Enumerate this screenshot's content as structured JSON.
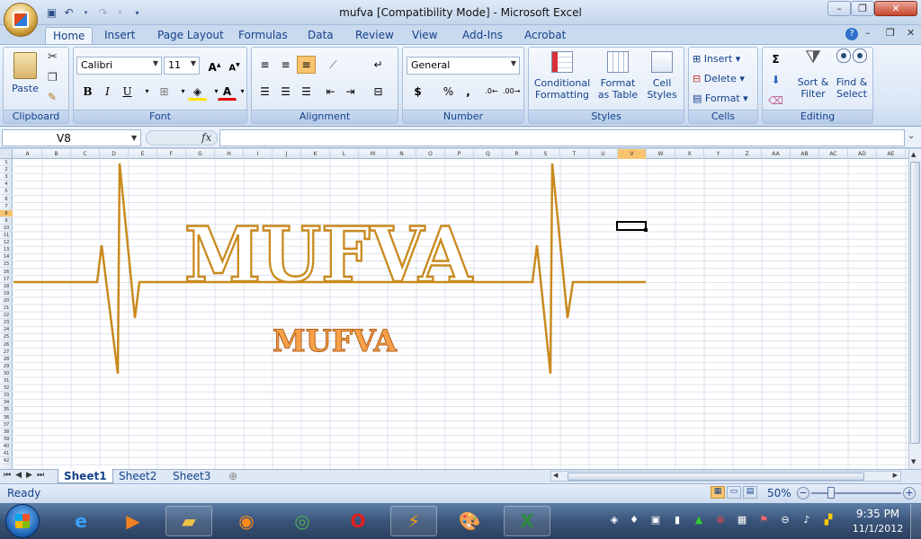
{
  "window": {
    "title": "mufva  [Compatibility Mode] - Microsoft Excel",
    "minimize": "–",
    "maximize": "❐",
    "close": "✕"
  },
  "ribbon_tabs": [
    "Home",
    "Insert",
    "Page Layout",
    "Formulas",
    "Data",
    "Review",
    "View",
    "Add-Ins",
    "Acrobat"
  ],
  "groups": {
    "clipboard": {
      "label": "Clipboard",
      "paste": "Paste"
    },
    "font": {
      "label": "Font",
      "family": "Calibri",
      "size": "11"
    },
    "alignment": {
      "label": "Alignment"
    },
    "number": {
      "label": "Number",
      "format": "General",
      "currency": "$",
      "percent": "%",
      "comma": ","
    },
    "styles": {
      "label": "Styles",
      "conditional": "Conditional",
      "formatting": "Formatting",
      "format_as": "Format",
      "as_table": "as Table",
      "cell": "Cell",
      "cell_styles": "Styles"
    },
    "cells": {
      "label": "Cells",
      "insert": "Insert",
      "delete": "Delete",
      "format": "Format"
    },
    "editing": {
      "label": "Editing",
      "sort": "Sort &",
      "filter": "Filter",
      "find": "Find &",
      "select": "Select"
    }
  },
  "formula_bar": {
    "name_box": "V8",
    "fx": "fx",
    "content": ""
  },
  "columns": [
    "A",
    "B",
    "C",
    "D",
    "E",
    "F",
    "G",
    "H",
    "I",
    "J",
    "K",
    "L",
    "M",
    "N",
    "O",
    "P",
    "Q",
    "R",
    "S",
    "T",
    "U",
    "V",
    "W",
    "X",
    "Y",
    "Z",
    "AA",
    "AB",
    "AC",
    "AD",
    "AE"
  ],
  "rows": [
    "1",
    "2",
    "3",
    "4",
    "5",
    "6",
    "7",
    "8",
    "9",
    "10",
    "11",
    "12",
    "13",
    "14",
    "15",
    "16",
    "17",
    "18",
    "19",
    "20",
    "21",
    "22",
    "23",
    "24",
    "25",
    "26",
    "27",
    "28",
    "29",
    "30",
    "31",
    "32",
    "33",
    "34",
    "35",
    "36",
    "37",
    "38",
    "39",
    "40",
    "41",
    "42"
  ],
  "active_column": "V",
  "active_row": "8",
  "artwork": {
    "big_text": "MUFVA",
    "small_text": "MUFVA",
    "color": "#c98a1e"
  },
  "sheets": [
    "Sheet1",
    "Sheet2",
    "Sheet3"
  ],
  "active_sheet": "Sheet1",
  "status": {
    "ready": "Ready",
    "zoom": "50%"
  },
  "taskbar": {
    "time": "9:35 PM",
    "date": "11/1/2012"
  }
}
